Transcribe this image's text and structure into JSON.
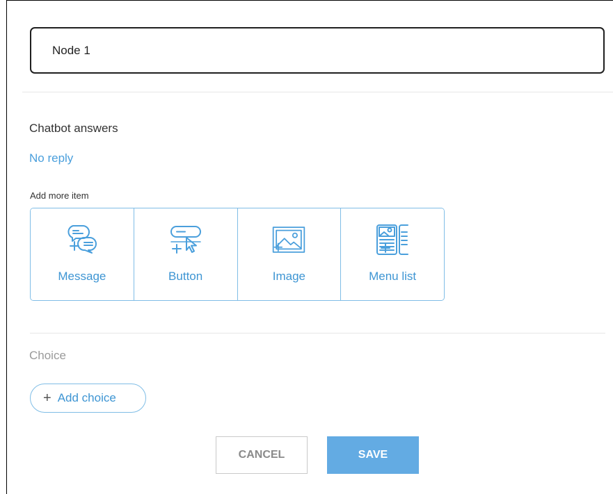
{
  "node": {
    "name_value": "Node 1"
  },
  "chatbot_answers": {
    "title": "Chatbot answers",
    "reply_status": "No reply"
  },
  "add_more": {
    "label": "Add more item",
    "items": [
      {
        "label": "Message",
        "icon": "message-add-icon"
      },
      {
        "label": "Button",
        "icon": "button-add-icon"
      },
      {
        "label": "Image",
        "icon": "image-add-icon"
      },
      {
        "label": "Menu list",
        "icon": "menu-list-add-icon"
      }
    ]
  },
  "choice": {
    "title": "Choice",
    "add_label": "Add choice",
    "add_icon": "plus-icon"
  },
  "actions": {
    "cancel_label": "CANCEL",
    "save_label": "SAVE"
  },
  "colors": {
    "accent": "#3e95d3",
    "accent_border": "#7fbde6",
    "save_bg": "#63abe3",
    "muted_text": "#9a9a9a"
  }
}
